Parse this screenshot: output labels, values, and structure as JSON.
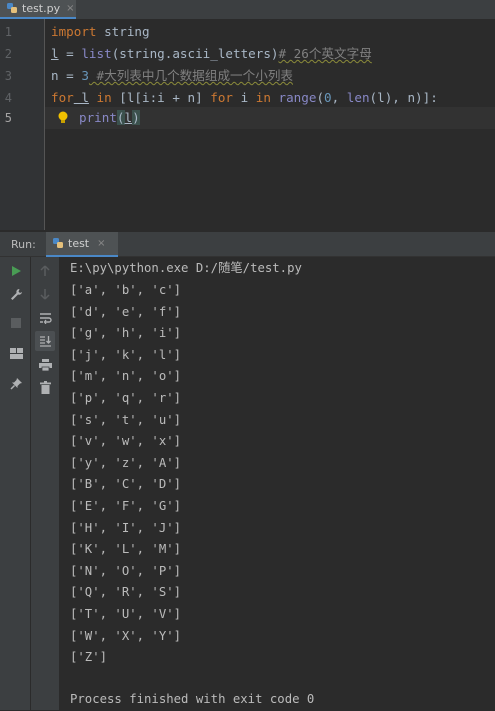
{
  "editor": {
    "tab": {
      "label": "test.py",
      "close": "×"
    },
    "line_numbers": [
      "1",
      "2",
      "3",
      "4",
      "5"
    ],
    "code": {
      "l1_kw": "import",
      "l1_rest": " string",
      "l2_var": "l",
      "l2_eq": " = ",
      "l2_fn": "list",
      "l2_args": "(string.ascii_letters)",
      "l2_cmt": "# 26个英文字母",
      "l3_a": "n = ",
      "l3_num": "3",
      "l3_cmt": " #大列表中几个数据组成一个小列表",
      "l4_for": "for",
      "l4_var": " l",
      "l4_in": " in",
      "l4_mid": " [l[i:i + n] ",
      "l4_for2": "for",
      "l4_i": " i ",
      "l4_in2": "in",
      "l4_sp": " ",
      "l4_range": "range",
      "l4_p1": "(",
      "l4_zero": "0",
      "l4_p2": ", ",
      "l4_len": "len",
      "l4_p3": "(l), n)]:",
      "l5_print": "print",
      "l5_open": "(",
      "l5_arg": "l",
      "l5_close": ")"
    }
  },
  "run": {
    "title": "Run:",
    "tab": {
      "label": "test",
      "close": "×"
    },
    "command": "E:\\py\\python.exe D:/随笔/test.py",
    "output": [
      "['a', 'b', 'c']",
      "['d', 'e', 'f']",
      "['g', 'h', 'i']",
      "['j', 'k', 'l']",
      "['m', 'n', 'o']",
      "['p', 'q', 'r']",
      "['s', 't', 'u']",
      "['v', 'w', 'x']",
      "['y', 'z', 'A']",
      "['B', 'C', 'D']",
      "['E', 'F', 'G']",
      "['H', 'I', 'J']",
      "['K', 'L', 'M']",
      "['N', 'O', 'P']",
      "['Q', 'R', 'S']",
      "['T', 'U', 'V']",
      "['W', 'X', 'Y']",
      "['Z']"
    ],
    "exit_message": "Process finished with exit code 0"
  },
  "icons": {
    "run": "play-icon",
    "settings": "wrench-icon",
    "stop": "stop-icon",
    "layout": "layout-icon",
    "pin": "pin-icon",
    "up": "arrow-up-icon",
    "down": "arrow-down-icon",
    "wrap": "soft-wrap-icon",
    "scroll": "scroll-to-end-icon",
    "print": "print-icon",
    "trash": "trash-icon",
    "bulb": "lightbulb-icon"
  },
  "colors": {
    "keyword": "#cc7832",
    "builtin": "#8888c6",
    "number": "#6897bb",
    "comment": "#808080",
    "text": "#a9b7c6",
    "run_green": "#499c54"
  }
}
